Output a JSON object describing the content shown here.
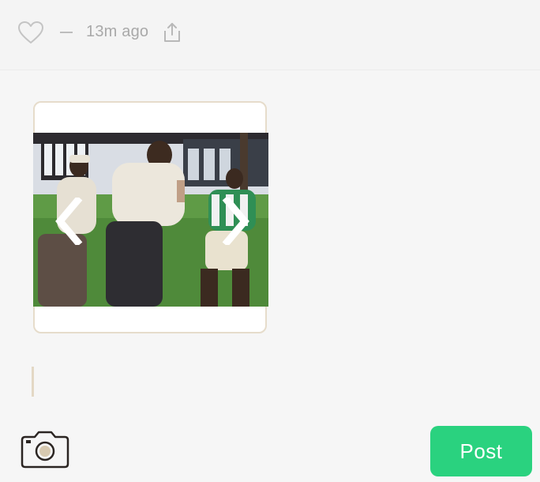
{
  "post_meta": {
    "separator": "—",
    "timestamp": "13m ago"
  },
  "icons": {
    "like": "heart-outline",
    "share": "share-upload",
    "attach": "camera",
    "prev": "chevron-left",
    "next": "chevron-right"
  },
  "composer": {
    "post_label": "Post"
  },
  "colors": {
    "post_button": "#2ad27f",
    "card_border": "#e6dccb",
    "muted_text": "#a9a9a9"
  }
}
